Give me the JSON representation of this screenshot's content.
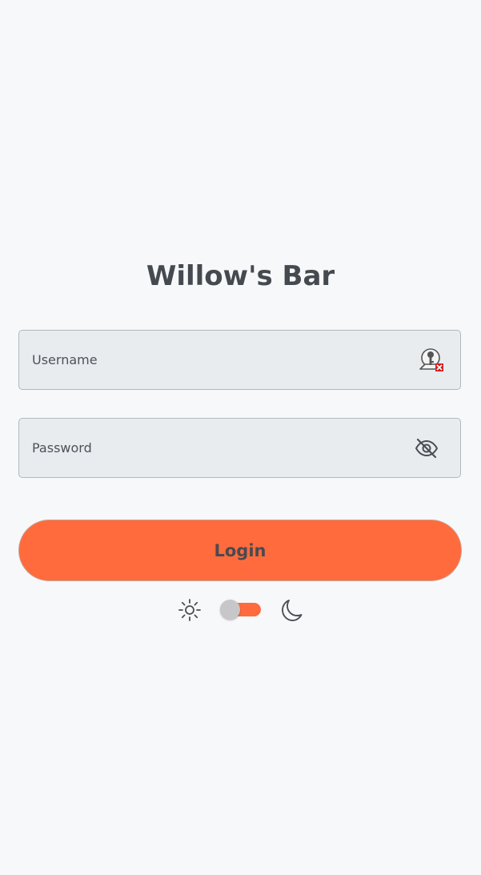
{
  "app": {
    "title": "Willow's Bar"
  },
  "form": {
    "username": {
      "placeholder": "Username",
      "value": "",
      "icon": "key-lock-icon"
    },
    "password": {
      "placeholder": "Password",
      "value": "",
      "icon": "eye-slash-icon"
    },
    "login_label": "Login"
  },
  "theme": {
    "light_icon": "sun-icon",
    "dark_icon": "moon-icon",
    "dark_mode": false
  },
  "colors": {
    "background": "#f7f8fa",
    "accent": "#ff6b3d",
    "text": "#454a50",
    "field_bg": "#e9ecef",
    "knob": "#c7c7c9"
  }
}
